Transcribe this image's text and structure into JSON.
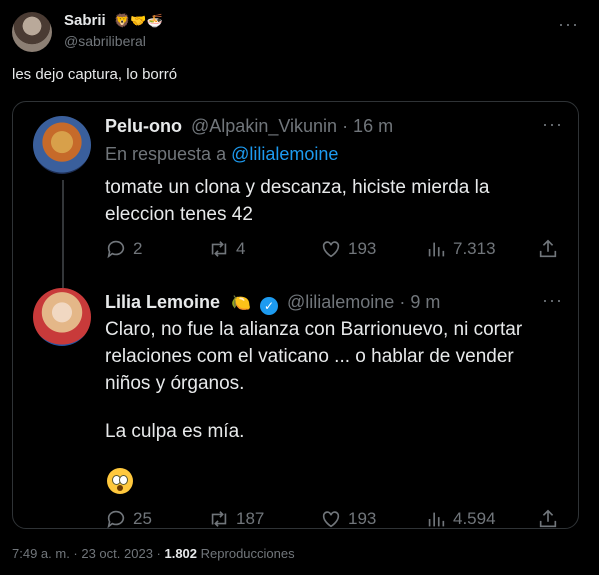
{
  "author": {
    "display_name": "Sabrii",
    "emojis": "🦁🤝🍜",
    "handle": "@sabriliberal"
  },
  "tweet_text": "les dejo captura, lo borró",
  "quoted": {
    "reply": {
      "name": "Pelu-ono",
      "handle": "@Alpakin_Vikunin",
      "time": "· 16 m",
      "reply_prefix": "En respuesta a",
      "reply_to": "@lilialemoine",
      "body": "tomate un clona y descanza, hiciste mierda la eleccion tenes 42",
      "stats": {
        "replies": "2",
        "retweets": "4",
        "likes": "193",
        "views": "7.313"
      }
    },
    "original": {
      "name": "Lilia Lemoine",
      "name_emoji": "🍋",
      "handle": "@lilialemoine",
      "time": "· 9 m",
      "body_1": "Claro, no fue la alianza con Barrionuevo, ni cortar relaciones com el vaticano ... o hablar de vender niños y órganos.",
      "body_2": "La culpa es mía.",
      "stats": {
        "replies": "25",
        "retweets": "187",
        "likes": "193",
        "views": "4.594"
      }
    }
  },
  "footer": {
    "timestamp": "7:49 a. m. · 23 oct. 2023 ·",
    "views": "1.802",
    "views_label": "Reproducciones"
  },
  "icons": [
    "more-icon",
    "reply-icon",
    "retweet-icon",
    "like-icon",
    "views-icon",
    "share-icon",
    "verified-icon"
  ]
}
